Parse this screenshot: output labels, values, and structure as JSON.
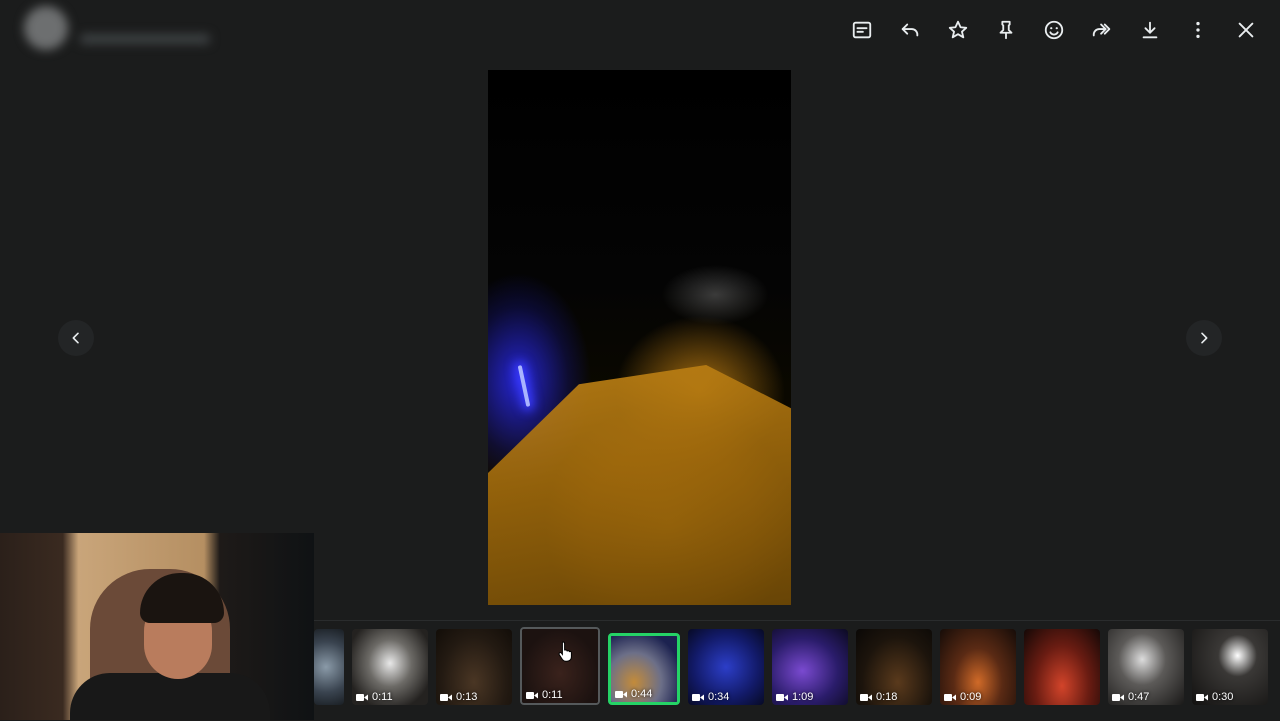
{
  "toolbar": {
    "actions": [
      "caption",
      "reply",
      "star",
      "pin",
      "react",
      "forward",
      "download",
      "more",
      "close"
    ]
  },
  "navigation": {
    "prev_icon": "chevron-left-icon",
    "next_icon": "chevron-right-icon"
  },
  "filmstrip": {
    "thumbnails": [
      {
        "duration": "",
        "tone": "cool-mist",
        "partial": true
      },
      {
        "duration": "0:11",
        "tone": "white-light"
      },
      {
        "duration": "0:13",
        "tone": "dark-amber"
      },
      {
        "duration": "0:11",
        "tone": "dark-red",
        "hover": true
      },
      {
        "duration": "0:44",
        "tone": "tent-blue",
        "selected": true
      },
      {
        "duration": "0:34",
        "tone": "blue-night"
      },
      {
        "duration": "1:09",
        "tone": "purple-lights"
      },
      {
        "duration": "0:18",
        "tone": "dark-fire"
      },
      {
        "duration": "0:09",
        "tone": "crowd-fire"
      },
      {
        "duration": "",
        "tone": "red-glow"
      },
      {
        "duration": "0:47",
        "tone": "gray-crowd"
      },
      {
        "duration": "0:30",
        "tone": "dark-crowd"
      }
    ]
  },
  "colors": {
    "background": "#1b1c1c",
    "selected_border": "#25d366",
    "icon": "#e9edef"
  }
}
